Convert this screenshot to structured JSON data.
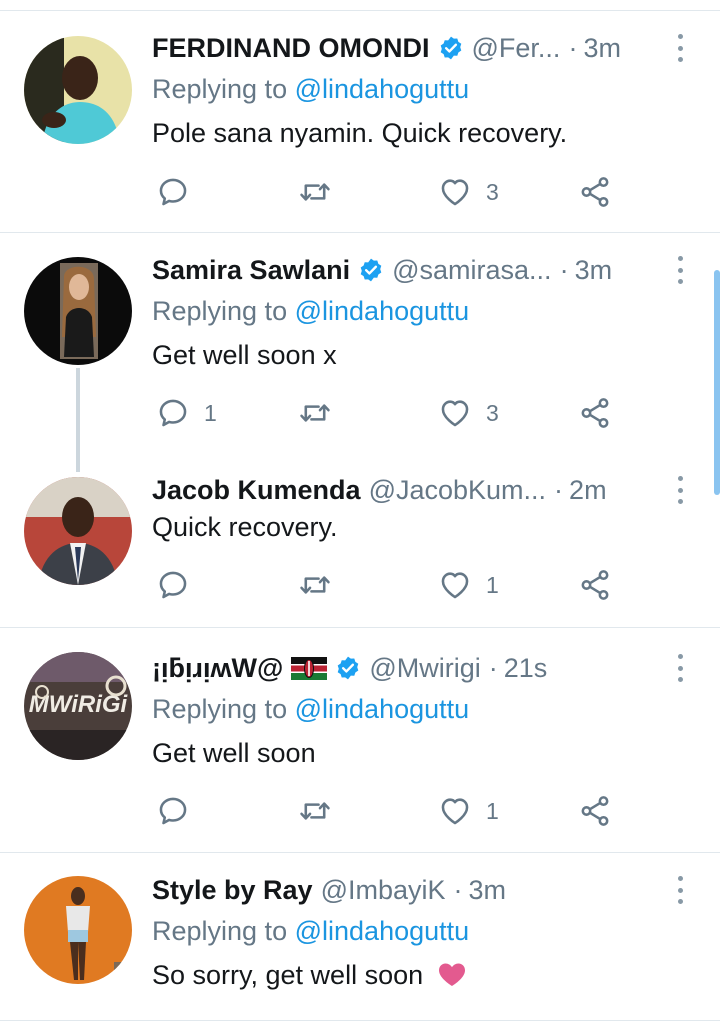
{
  "colors": {
    "accent": "#1b95e0",
    "muted": "#657786",
    "text": "#14171a",
    "divider": "#e1e8ed",
    "heart_emoji": "#e35a8f"
  },
  "icons": [
    "reply-icon",
    "retweet-icon",
    "like-icon",
    "share-icon",
    "verified-badge-icon",
    "more-options-icon",
    "kenya-flag-icon",
    "pink-heart-emoji"
  ],
  "tweets": [
    {
      "name": "FERDINAND OMONDI",
      "verified": true,
      "handle": "@Fer...",
      "separator": "·",
      "time": "3m",
      "replying_prefix": "Replying to",
      "replying_to": "@lindahoguttu",
      "text": "Pole sana  nyamin. Quick recovery.",
      "reply_count": "",
      "retweet_count": "",
      "like_count": "3"
    },
    {
      "name": "Samira Sawlani",
      "verified": true,
      "handle": "@samirasa...",
      "separator": "·",
      "time": "3m",
      "replying_prefix": "Replying to",
      "replying_to": "@lindahoguttu",
      "text": "Get well soon x",
      "reply_count": "1",
      "retweet_count": "",
      "like_count": "3"
    },
    {
      "name": "Jacob Kumenda",
      "verified": false,
      "handle": "@JacobKum...",
      "separator": "·",
      "time": "2m",
      "text": "Quick recovery.",
      "reply_count": "",
      "retweet_count": "",
      "like_count": "1"
    },
    {
      "name": "¡ᴉƃᴉɹᴉʍW@",
      "verified": true,
      "handle": "@Mwirigi",
      "separator": "·",
      "time": "21s",
      "replying_prefix": "Replying to",
      "replying_to": "@lindahoguttu",
      "text": "Get well soon",
      "reply_count": "",
      "retweet_count": "",
      "like_count": "1"
    },
    {
      "name": "Style by Ray",
      "verified": false,
      "handle": "@ImbayiK",
      "separator": "·",
      "time": "3m",
      "replying_prefix": "Replying to",
      "replying_to": "@lindahoguttu",
      "text": "So sorry, get well soon"
    }
  ]
}
